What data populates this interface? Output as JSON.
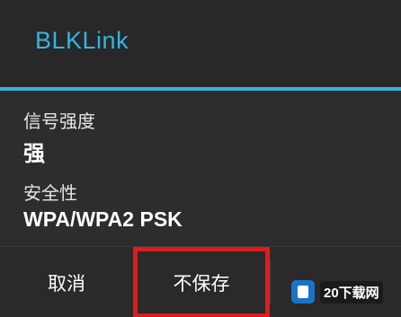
{
  "dialog": {
    "title": "BLKLink",
    "fields": [
      {
        "label": "信号强度",
        "value": "强"
      },
      {
        "label": "安全性",
        "value": "WPA/WPA2 PSK"
      }
    ],
    "buttons": {
      "cancel": "取消",
      "dont_save": "不保存"
    }
  },
  "watermark": {
    "text": "20下载网"
  },
  "colors": {
    "accent": "#33b5e5",
    "highlight_border": "#e01b1b",
    "background": "#2c2c2c"
  }
}
